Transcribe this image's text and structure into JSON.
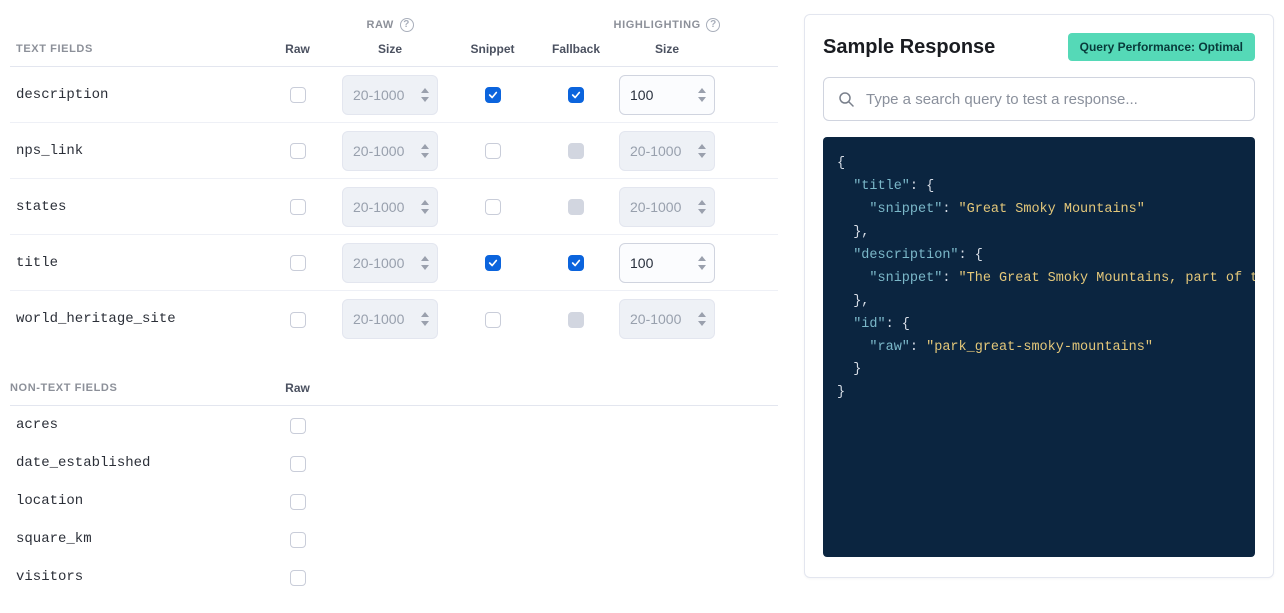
{
  "headers": {
    "text_fields": "TEXT FIELDS",
    "non_text_fields": "NON-TEXT FIELDS",
    "raw_group": "RAW",
    "highlighting_group": "HIGHLIGHTING",
    "raw": "Raw",
    "size_raw": "Size",
    "snippet": "Snippet",
    "fallback": "Fallback",
    "size_hl": "Size"
  },
  "placeholders": {
    "size_range": "20-1000",
    "search": "Type a search query to test a response..."
  },
  "text_fields": [
    {
      "name": "description",
      "raw": false,
      "raw_size": "",
      "snippet": true,
      "fallback": true,
      "fallback_enabled": true,
      "hl_size": "100",
      "hl_enabled": true
    },
    {
      "name": "nps_link",
      "raw": false,
      "raw_size": "",
      "snippet": false,
      "fallback": false,
      "fallback_enabled": false,
      "hl_size": "",
      "hl_enabled": false
    },
    {
      "name": "states",
      "raw": false,
      "raw_size": "",
      "snippet": false,
      "fallback": false,
      "fallback_enabled": false,
      "hl_size": "",
      "hl_enabled": false
    },
    {
      "name": "title",
      "raw": false,
      "raw_size": "",
      "snippet": true,
      "fallback": true,
      "fallback_enabled": true,
      "hl_size": "100",
      "hl_enabled": true
    },
    {
      "name": "world_heritage_site",
      "raw": false,
      "raw_size": "",
      "snippet": false,
      "fallback": false,
      "fallback_enabled": false,
      "hl_size": "",
      "hl_enabled": false
    }
  ],
  "non_text_fields": [
    {
      "name": "acres",
      "raw": false
    },
    {
      "name": "date_established",
      "raw": false
    },
    {
      "name": "location",
      "raw": false
    },
    {
      "name": "square_km",
      "raw": false
    },
    {
      "name": "visitors",
      "raw": false
    }
  ],
  "panel": {
    "title": "Sample Response",
    "badge": "Query Performance: Optimal"
  },
  "sample_response": {
    "title": {
      "snippet": "Great Smoky Mountains"
    },
    "description": {
      "snippet": "The Great Smoky Mountains, part of the Appalachian"
    },
    "id": {
      "raw": "park_great-smoky-mountains"
    }
  }
}
